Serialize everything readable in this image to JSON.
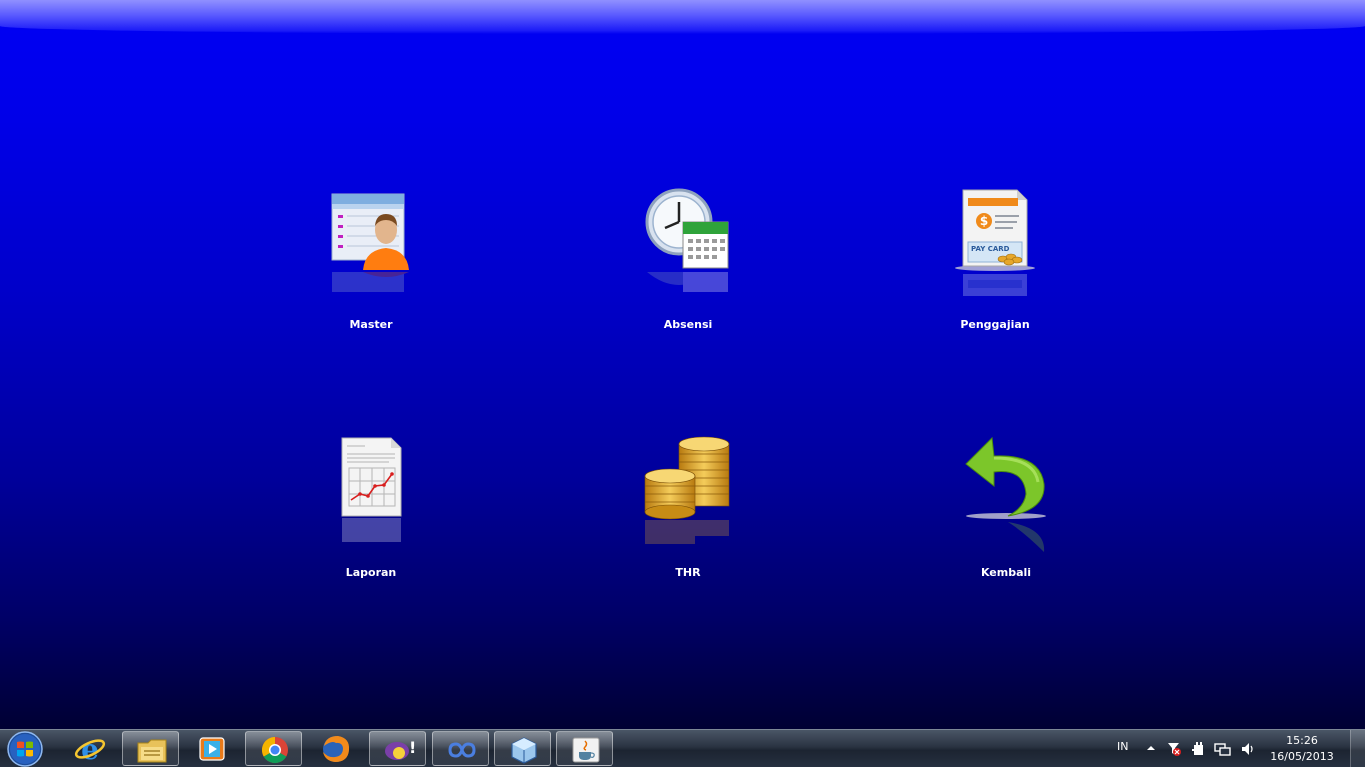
{
  "menu": {
    "items": [
      {
        "label": "Master",
        "icon": "user-card-icon"
      },
      {
        "label": "Absensi",
        "icon": "clock-calendar-icon"
      },
      {
        "label": "Penggajian",
        "icon": "pay-card-icon"
      },
      {
        "label": "Laporan",
        "icon": "report-chart-icon"
      },
      {
        "label": "THR",
        "icon": "coin-stack-icon"
      },
      {
        "label": "Kembali",
        "icon": "back-arrow-icon"
      }
    ]
  },
  "taskbar": {
    "apps": [
      {
        "name": "internet-explorer",
        "icon": "internet-explorer-icon"
      },
      {
        "name": "file-explorer",
        "icon": "folder-icon"
      },
      {
        "name": "media-player",
        "icon": "media-player-icon"
      },
      {
        "name": "chrome",
        "icon": "chrome-icon"
      },
      {
        "name": "firefox",
        "icon": "firefox-icon"
      },
      {
        "name": "yahoo-messenger",
        "icon": "yahoo-messenger-icon"
      },
      {
        "name": "infinity-app",
        "icon": "infinity-icon"
      },
      {
        "name": "virtualbox",
        "icon": "cube-icon"
      },
      {
        "name": "java",
        "icon": "java-icon"
      }
    ],
    "tray": {
      "language": "IN",
      "time": "15:26",
      "date": "16/05/2013"
    }
  },
  "colors": {
    "desktop_top": "#0000f5",
    "desktop_bottom": "#000033",
    "label": "#ffffff",
    "arrow_green": "#7cc62a",
    "coin_gold": "#e0a521"
  }
}
